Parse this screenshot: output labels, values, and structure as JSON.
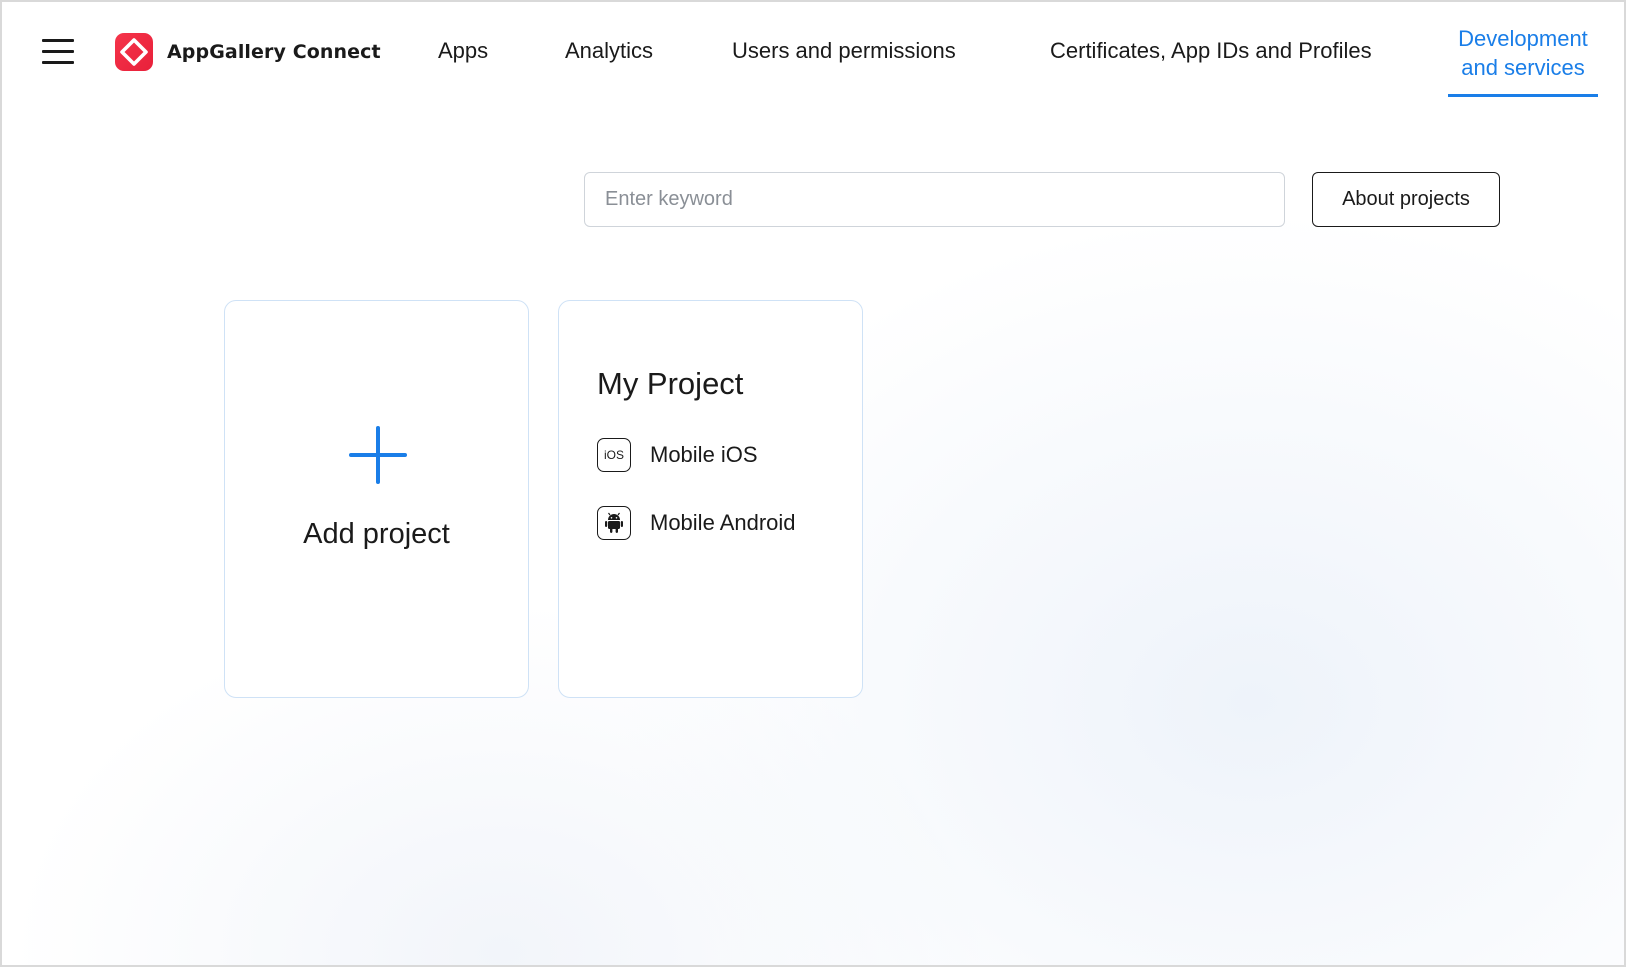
{
  "brand": {
    "name": "AppGallery Connect",
    "color": "#e8203a"
  },
  "nav": {
    "items": [
      {
        "label": "Apps"
      },
      {
        "label": "Analytics"
      },
      {
        "label": "Users and permissions"
      },
      {
        "label": "Certificates, App IDs and Profiles"
      }
    ],
    "active": {
      "line1": "Development",
      "line2": "and services"
    },
    "accent": "#1a7ee8"
  },
  "search": {
    "placeholder": "Enter keyword",
    "value": ""
  },
  "about_button": {
    "label": "About projects"
  },
  "add_card": {
    "label": "Add project",
    "icon": "plus-icon"
  },
  "project": {
    "title": "My Project",
    "platforms": [
      {
        "icon": "ios-icon",
        "icon_text": "iOS",
        "label": "Mobile iOS"
      },
      {
        "icon": "android-icon",
        "label": "Mobile Android"
      }
    ]
  }
}
